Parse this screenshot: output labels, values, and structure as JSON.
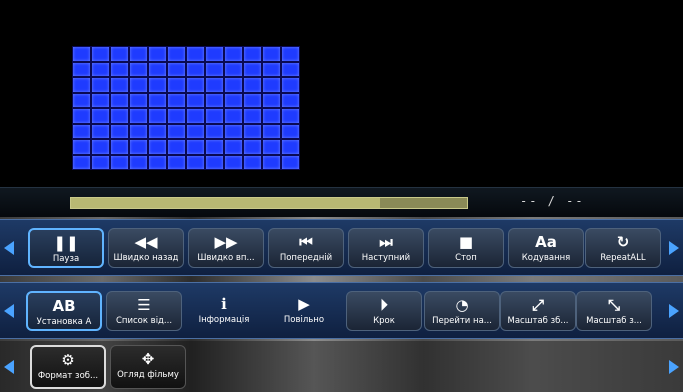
{
  "player": {
    "time_display": "-- / --",
    "progress": 0.78
  },
  "rows": [
    {
      "buttons": [
        {
          "label": "Пауза",
          "icon": "pause-icon",
          "glyph": "❚❚"
        },
        {
          "label": "Швидко назад",
          "icon": "rewind-icon",
          "glyph": "◀◀"
        },
        {
          "label": "Швидко вп...",
          "icon": "fast-forward-icon",
          "glyph": "▶▶"
        },
        {
          "label": "Попередній",
          "icon": "skip-previous-icon",
          "glyph": "⏮"
        },
        {
          "label": "Наступний",
          "icon": "skip-next-icon",
          "glyph": "⏭"
        },
        {
          "label": "Стоп",
          "icon": "stop-icon",
          "glyph": "■"
        },
        {
          "label": "Кодування",
          "icon": "encoding-icon",
          "glyph": "Aa"
        },
        {
          "label": "RepeatALL",
          "icon": "repeat-icon",
          "glyph": "↻"
        }
      ]
    },
    {
      "buttons": [
        {
          "label": "Установка А",
          "icon": "ab-repeat-icon",
          "glyph": "AB"
        },
        {
          "label": "Список від...",
          "icon": "list-icon",
          "glyph": "☰"
        },
        {
          "label": "Інформація",
          "icon": "info-icon",
          "glyph": "ℹ"
        },
        {
          "label": "Повільно",
          "icon": "slow-motion-icon",
          "glyph": "▶"
        },
        {
          "label": "Крок",
          "icon": "step-icon",
          "glyph": "⏵"
        },
        {
          "label": "Перейти на...",
          "icon": "goto-time-icon",
          "glyph": "◔"
        },
        {
          "label": "Масштаб зб...",
          "icon": "zoom-in-icon",
          "glyph": "⤢"
        },
        {
          "label": "Масштаб з...",
          "icon": "zoom-out-icon",
          "glyph": "⤡"
        }
      ]
    },
    {
      "buttons": [
        {
          "label": "Формат зоб...",
          "icon": "gear-icon",
          "glyph": "⚙"
        },
        {
          "label": "Огляд фільму",
          "icon": "move-icon",
          "glyph": "✥"
        }
      ]
    }
  ]
}
